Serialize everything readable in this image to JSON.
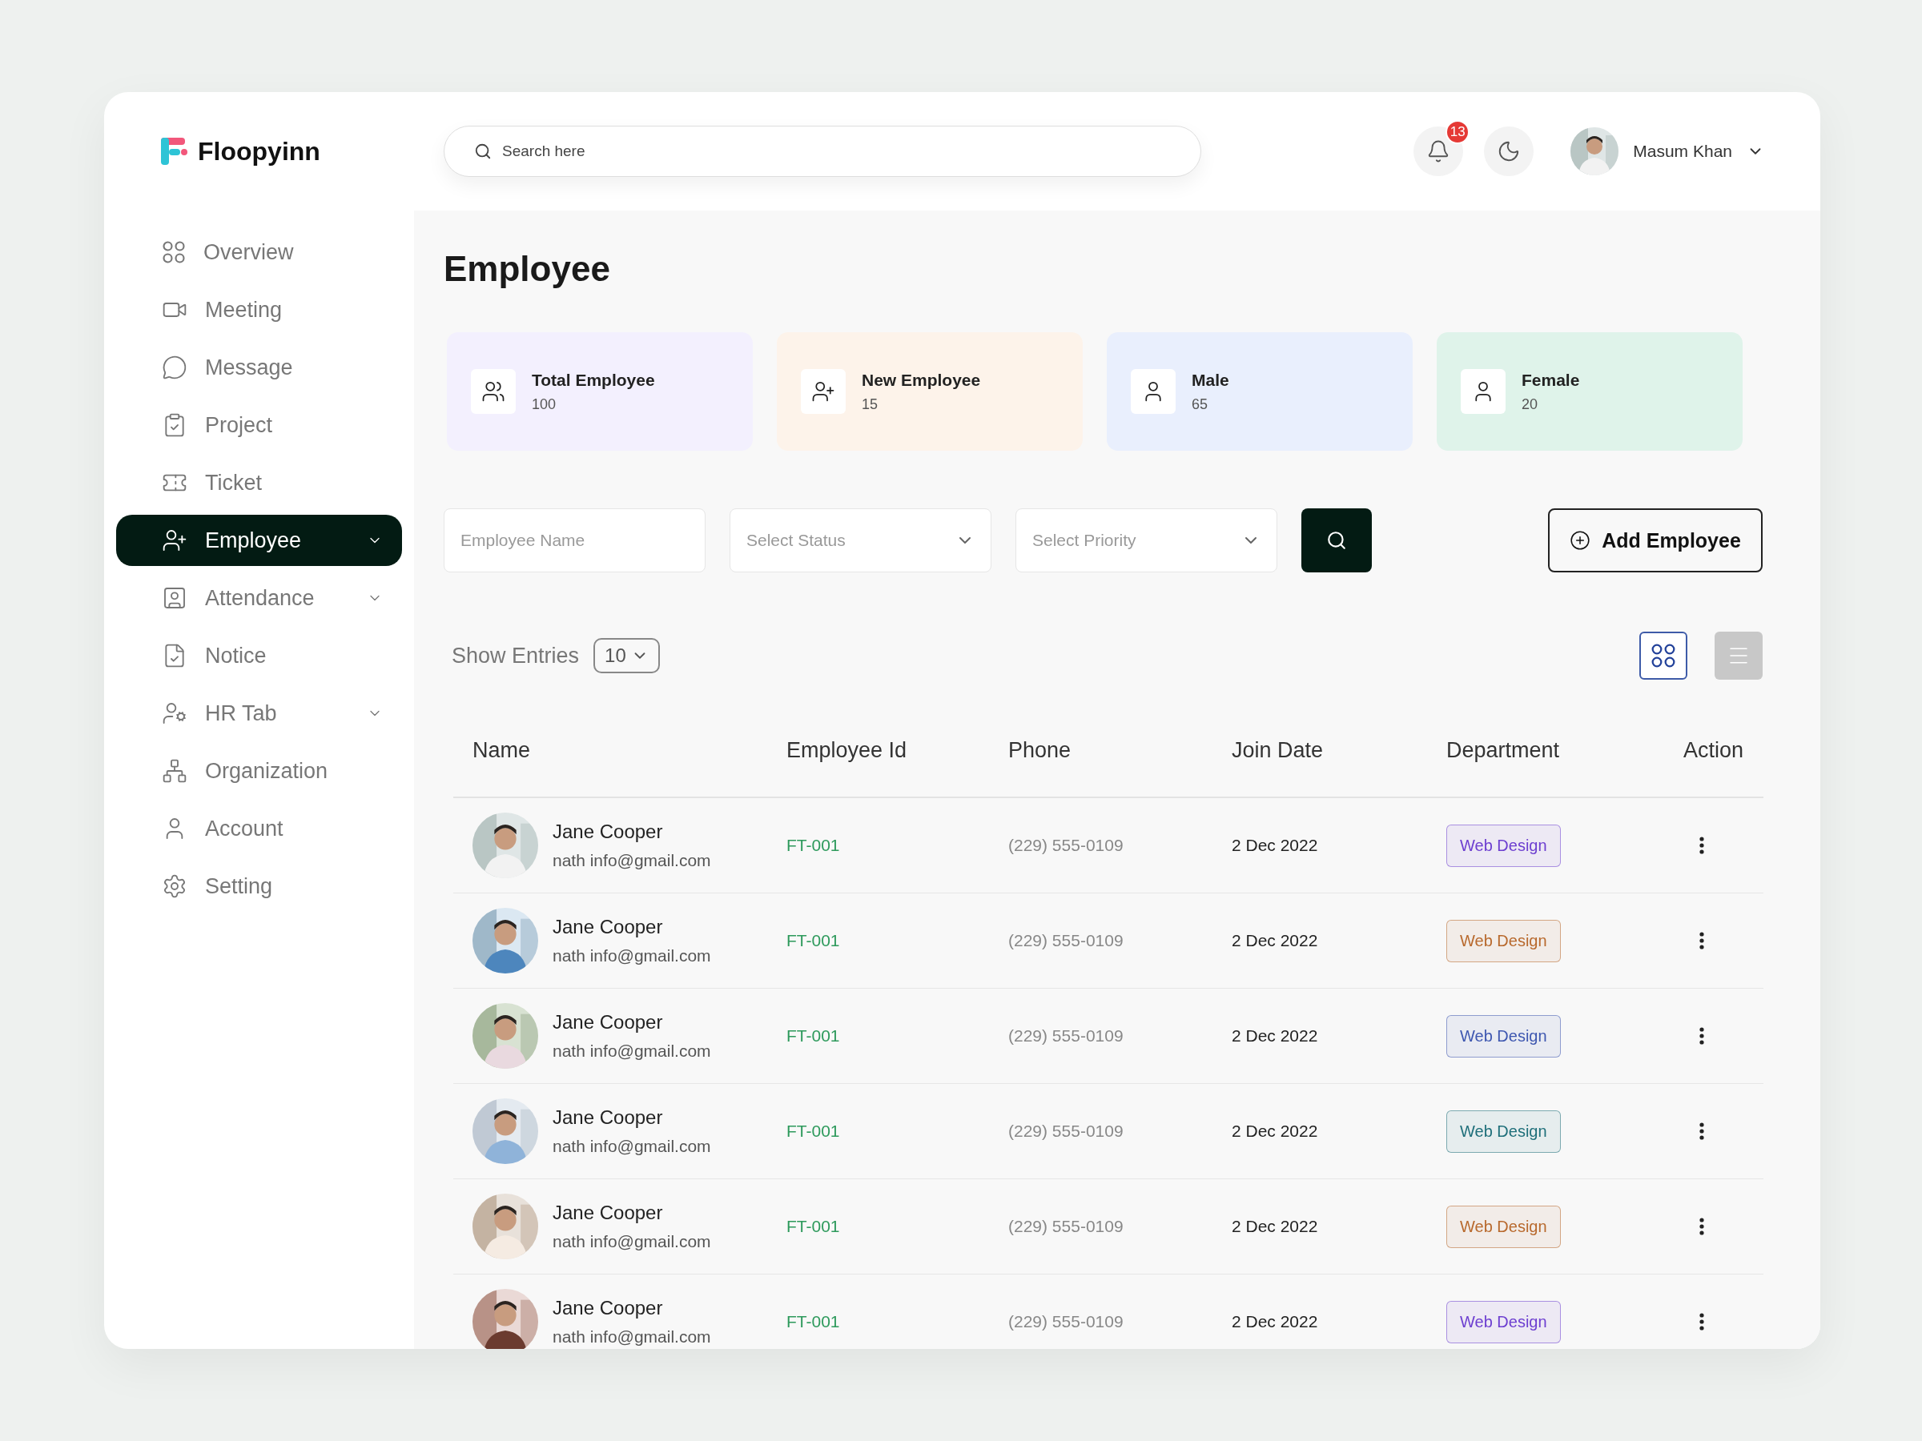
{
  "brand": {
    "name": "Floopyinn"
  },
  "search": {
    "placeholder": "Search here"
  },
  "notifications": {
    "count": "13"
  },
  "user": {
    "name": "Masum Khan"
  },
  "sidebar": {
    "items": [
      {
        "label": "Overview",
        "selected": false,
        "submenu": false
      },
      {
        "label": "Meeting",
        "selected": false,
        "submenu": false
      },
      {
        "label": "Message",
        "selected": false,
        "submenu": false
      },
      {
        "label": "Project",
        "selected": false,
        "submenu": false
      },
      {
        "label": "Ticket",
        "selected": false,
        "submenu": false
      },
      {
        "label": "Employee",
        "selected": true,
        "submenu": true
      },
      {
        "label": "Attendance",
        "selected": false,
        "submenu": true
      },
      {
        "label": "Notice",
        "selected": false,
        "submenu": false
      },
      {
        "label": "HR Tab",
        "selected": false,
        "submenu": true
      },
      {
        "label": "Organization",
        "selected": false,
        "submenu": false
      },
      {
        "label": "Account",
        "selected": false,
        "submenu": false
      },
      {
        "label": "Setting",
        "selected": false,
        "submenu": false
      }
    ]
  },
  "page_title": "Employee",
  "stats": [
    {
      "label": "Total Employee",
      "value": "100",
      "color": "#f3f0fe"
    },
    {
      "label": "New Employee",
      "value": "15",
      "color": "#fdf3ea"
    },
    {
      "label": "Male",
      "value": "65",
      "color": "#e9effd"
    },
    {
      "label": "Female",
      "value": "20",
      "color": "#dff3ea"
    }
  ],
  "filters": [
    {
      "kind": "text",
      "placeholder": "Employee Name"
    },
    {
      "kind": "select",
      "placeholder": "Select Status"
    },
    {
      "kind": "select",
      "placeholder": "Select Priority"
    }
  ],
  "add_button": "Add Employee",
  "entries": {
    "label": "Show Entries",
    "value": "10"
  },
  "view_toggle": [
    {
      "selected": true
    },
    {
      "selected": false
    }
  ],
  "table": {
    "columns": [
      "Name",
      "Employee Id",
      "Phone",
      "Join Date",
      "Department",
      "Action"
    ],
    "rows": [
      {
        "name": "Jane Cooper",
        "email": "nath info@gmail.com",
        "id": "FT-001",
        "phone": "(229) 555-0109",
        "date": "2 Dec 2022",
        "department": "Web Design",
        "color": "#6d3fd0"
      },
      {
        "name": "Jane Cooper",
        "email": "nath info@gmail.com",
        "id": "FT-001",
        "phone": "(229) 555-0109",
        "date": "2 Dec 2022",
        "department": "Web Design",
        "color": "#b8692d"
      },
      {
        "name": "Jane Cooper",
        "email": "nath info@gmail.com",
        "id": "FT-001",
        "phone": "(229) 555-0109",
        "date": "2 Dec 2022",
        "department": "Web Design",
        "color": "#3e57b0"
      },
      {
        "name": "Jane Cooper",
        "email": "nath info@gmail.com",
        "id": "FT-001",
        "phone": "(229) 555-0109",
        "date": "2 Dec 2022",
        "department": "Web Design",
        "color": "#1f6f7a"
      },
      {
        "name": "Jane Cooper",
        "email": "nath info@gmail.com",
        "id": "FT-001",
        "phone": "(229) 555-0109",
        "date": "2 Dec 2022",
        "department": "Web Design",
        "color": "#b8692d"
      },
      {
        "name": "Jane Cooper",
        "email": "nath info@gmail.com",
        "id": "FT-001",
        "phone": "(229) 555-0109",
        "date": "2 Dec 2022",
        "department": "Web Design",
        "color": "#6d3fd0"
      }
    ]
  }
}
